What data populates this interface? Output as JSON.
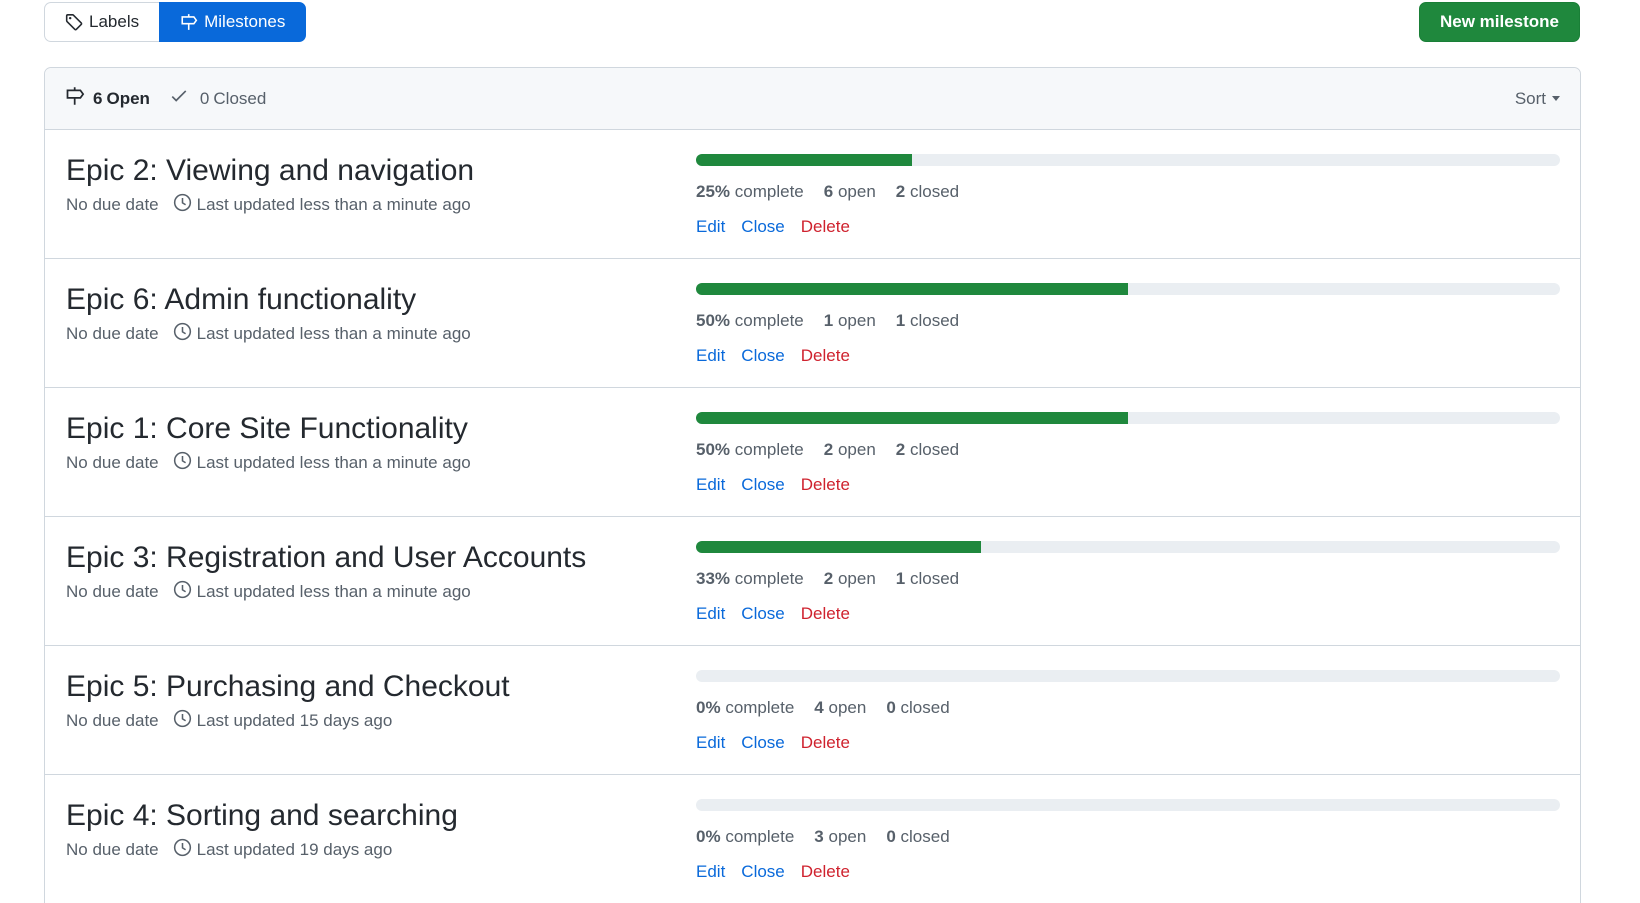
{
  "subnav": {
    "labels": "Labels",
    "milestones": "Milestones"
  },
  "new_milestone": "New milestone",
  "header": {
    "open_count": "6",
    "open_label": "Open",
    "closed_count": "0",
    "closed_label": "Closed",
    "sort": "Sort"
  },
  "milestones": [
    {
      "title": "Epic 2: Viewing and navigation",
      "due": "No due date",
      "updated": "Last updated less than a minute ago",
      "percent": 25,
      "percent_label": "25%",
      "complete": "complete",
      "open": "6",
      "open_label": "open",
      "closed": "2",
      "closed_label": "closed"
    },
    {
      "title": "Epic 6: Admin functionality",
      "due": "No due date",
      "updated": "Last updated less than a minute ago",
      "percent": 50,
      "percent_label": "50%",
      "complete": "complete",
      "open": "1",
      "open_label": "open",
      "closed": "1",
      "closed_label": "closed"
    },
    {
      "title": "Epic 1: Core Site Functionality",
      "due": "No due date",
      "updated": "Last updated less than a minute ago",
      "percent": 50,
      "percent_label": "50%",
      "complete": "complete",
      "open": "2",
      "open_label": "open",
      "closed": "2",
      "closed_label": "closed"
    },
    {
      "title": "Epic 3: Registration and User Accounts",
      "due": "No due date",
      "updated": "Last updated less than a minute ago",
      "percent": 33,
      "percent_label": "33%",
      "complete": "complete",
      "open": "2",
      "open_label": "open",
      "closed": "1",
      "closed_label": "closed"
    },
    {
      "title": "Epic 5: Purchasing and Checkout",
      "due": "No due date",
      "updated": "Last updated 15 days ago",
      "percent": 0,
      "percent_label": "0%",
      "complete": "complete",
      "open": "4",
      "open_label": "open",
      "closed": "0",
      "closed_label": "closed"
    },
    {
      "title": "Epic 4: Sorting and searching",
      "due": "No due date",
      "updated": "Last updated 19 days ago",
      "percent": 0,
      "percent_label": "0%",
      "complete": "complete",
      "open": "3",
      "open_label": "open",
      "closed": "0",
      "closed_label": "closed"
    }
  ],
  "actions": {
    "edit": "Edit",
    "close": "Close",
    "delete": "Delete"
  },
  "colors": {
    "accent": "#0969da",
    "success": "#1f883d",
    "danger": "#cf222e"
  }
}
